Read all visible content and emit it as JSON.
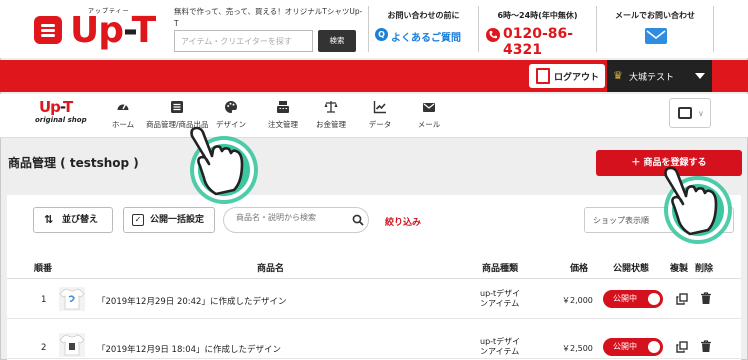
{
  "header": {
    "logo_ruby": "アップティー",
    "logo_main": "Up",
    "logo_dash": "-",
    "logo_end": "T",
    "tagline": "無料で作って、売って、買える！オリジナルTシャツUp-T",
    "search": {
      "placeholder": "アイテム・クリエイターを探す",
      "button": "検索"
    },
    "faq": {
      "title": "お問い合わせの前に",
      "link": "よくあるご質問",
      "q": "Q"
    },
    "tel": {
      "title": "6時〜24時(年中無休)",
      "number": "0120-86-4321"
    },
    "mail": {
      "title": "メールでお問い合わせ"
    }
  },
  "account": {
    "logout": "ログアウト",
    "user_name": "大城テスト"
  },
  "shop_logo": {
    "main": "Up",
    "dash": "-",
    "end": "T",
    "sub": "original shop"
  },
  "nav": {
    "items": [
      {
        "label": "ホーム",
        "icon": "dashboard-icon"
      },
      {
        "label": "商品管理/商品出品",
        "icon": "list-icon"
      },
      {
        "label": "デザイン",
        "icon": "palette-icon"
      },
      {
        "label": "注文管理",
        "icon": "register-icon"
      },
      {
        "label": "お金管理",
        "icon": "scale-icon"
      },
      {
        "label": "データ",
        "icon": "chart-icon"
      },
      {
        "label": "メール",
        "icon": "mail-icon"
      }
    ]
  },
  "page": {
    "title": "商品管理 ( testshop )",
    "register_button": "＋ 商品を登録する"
  },
  "toolbar": {
    "sort": "並び替え",
    "bulk_publish": "公開一括設定",
    "search_placeholder": "商品名・説明から検索",
    "filter": "絞り込み",
    "order_select": "ショップ表示順"
  },
  "table": {
    "headers": {
      "no": "順番",
      "name": "商品名",
      "type": "商品種類",
      "price": "価格",
      "status": "公開状態",
      "copy": "複製",
      "delete": "削除"
    },
    "rows": [
      {
        "no": "1",
        "name": "「2019年12月29日 20:42」に作成したデザイン",
        "type_line1": "up-tデザイ",
        "type_line2": "ンアイテム",
        "price": "￥2,000",
        "status": "公開中"
      },
      {
        "no": "2",
        "name": "「2019年12月9日 18:04」に作成したデザイン",
        "type_line1": "up-tデザイ",
        "type_line2": "ンアイテム",
        "price": "￥2,500",
        "status": "公開中"
      }
    ]
  },
  "colors": {
    "brand_red": "#e0161d",
    "accent_blue": "#1b7fd8",
    "tap_green": "#3cc7a0"
  }
}
